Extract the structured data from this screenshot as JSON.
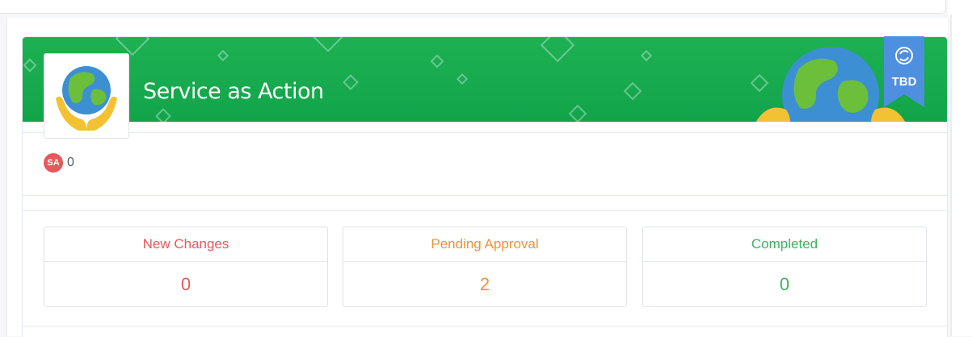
{
  "card": {
    "title": "Service as Action",
    "ribbon": {
      "text": "TBD",
      "icon": "refresh-icon",
      "color": "#4f8fe0"
    },
    "banner_color": "#17aa4e",
    "badge": {
      "initials": "SA",
      "count": "0",
      "color": "#e8585a"
    }
  },
  "stats": [
    {
      "label": "New Changes",
      "value": "0",
      "color": "#e8585a"
    },
    {
      "label": "Pending Approval",
      "value": "2",
      "color": "#f0923a"
    },
    {
      "label": "Completed",
      "value": "0",
      "color": "#3cb35e"
    }
  ]
}
